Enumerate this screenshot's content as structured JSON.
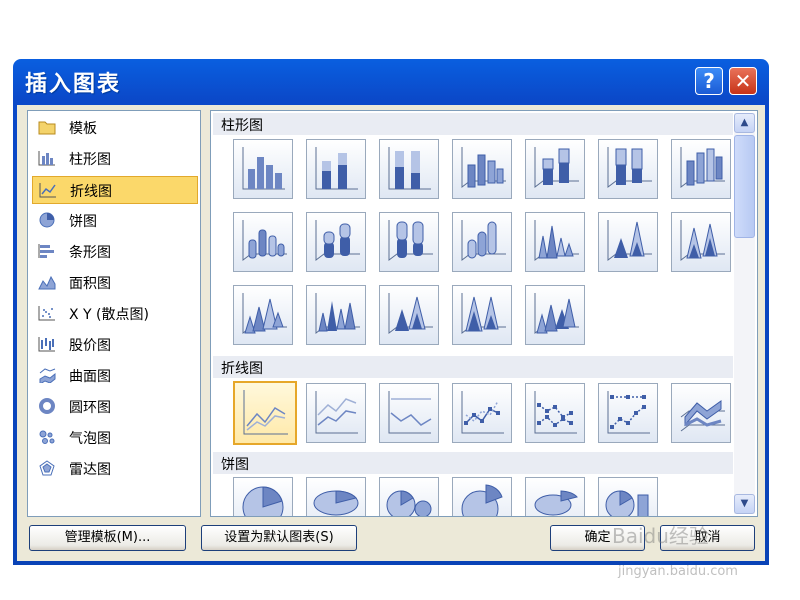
{
  "window": {
    "title": "插入图表",
    "help_label": "?",
    "close_label": "✕"
  },
  "categories": [
    {
      "label": "模板",
      "icon": "folder-icon"
    },
    {
      "label": "柱形图",
      "icon": "column-chart-icon"
    },
    {
      "label": "折线图",
      "icon": "line-chart-icon",
      "selected": true
    },
    {
      "label": "饼图",
      "icon": "pie-chart-icon"
    },
    {
      "label": "条形图",
      "icon": "bar-chart-icon"
    },
    {
      "label": "面积图",
      "icon": "area-chart-icon"
    },
    {
      "label": "X Y (散点图)",
      "icon": "scatter-chart-icon"
    },
    {
      "label": "股价图",
      "icon": "stock-chart-icon"
    },
    {
      "label": "曲面图",
      "icon": "surface-chart-icon"
    },
    {
      "label": "圆环图",
      "icon": "doughnut-chart-icon"
    },
    {
      "label": "气泡图",
      "icon": "bubble-chart-icon"
    },
    {
      "label": "雷达图",
      "icon": "radar-chart-icon"
    }
  ],
  "sections": {
    "column": "柱形图",
    "line": "折线图",
    "pie": "饼图"
  },
  "buttons": {
    "manage_templates": "管理模板(M)...",
    "set_default": "设置为默认图表(S)",
    "ok": "确定",
    "cancel": "取消"
  },
  "watermark": {
    "brand": "Baidu经验",
    "url": "jingyan.baidu.com"
  },
  "colors": {
    "titlebar": "#0a5fe0",
    "selection": "#fbd86a",
    "chart_blue": "#6d86c3"
  }
}
